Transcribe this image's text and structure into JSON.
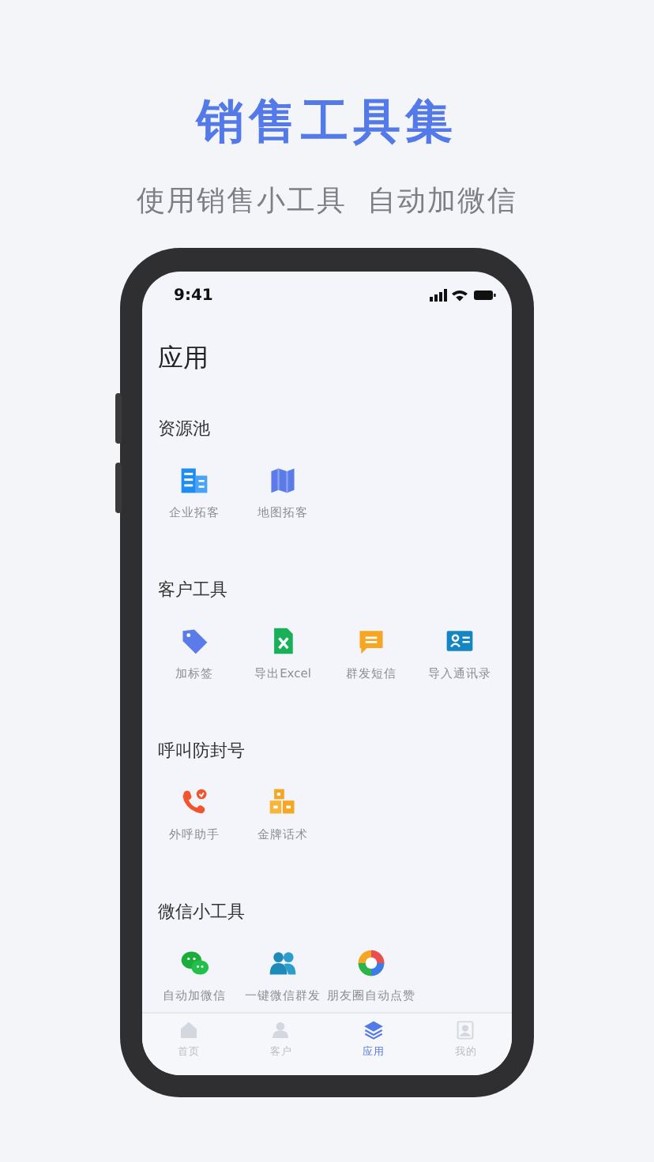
{
  "headline": "销售工具集",
  "subtitle": "使用销售小工具  自动加微信",
  "status_bar": {
    "time": "9:41"
  },
  "page_title": "应用",
  "sections": [
    {
      "title": "资源池",
      "tools": [
        {
          "kind": "building",
          "label": "企业拓客"
        },
        {
          "kind": "map",
          "label": "地图拓客"
        }
      ]
    },
    {
      "title": "客户工具",
      "tools": [
        {
          "kind": "tag",
          "label": "加标签"
        },
        {
          "kind": "excel",
          "label": "导出Excel"
        },
        {
          "kind": "sms",
          "label": "群发短信"
        },
        {
          "kind": "contact",
          "label": "导入通讯录"
        }
      ]
    },
    {
      "title": "呼叫防封号",
      "tools": [
        {
          "kind": "phone",
          "label": "外呼助手"
        },
        {
          "kind": "blocks",
          "label": "金牌话术"
        }
      ]
    },
    {
      "title": "微信小工具",
      "tools": [
        {
          "kind": "wechat",
          "label": "自动加微信"
        },
        {
          "kind": "people",
          "label": "一键微信群发"
        },
        {
          "kind": "aperture",
          "label": "朋友圈自动点赞"
        }
      ]
    }
  ],
  "tab_bar": [
    {
      "kind": "home",
      "label": "首页",
      "selected": false
    },
    {
      "kind": "customer",
      "label": "客户",
      "selected": false
    },
    {
      "kind": "layers",
      "label": "应用",
      "selected": true
    },
    {
      "kind": "profile",
      "label": "我的",
      "selected": false
    }
  ]
}
